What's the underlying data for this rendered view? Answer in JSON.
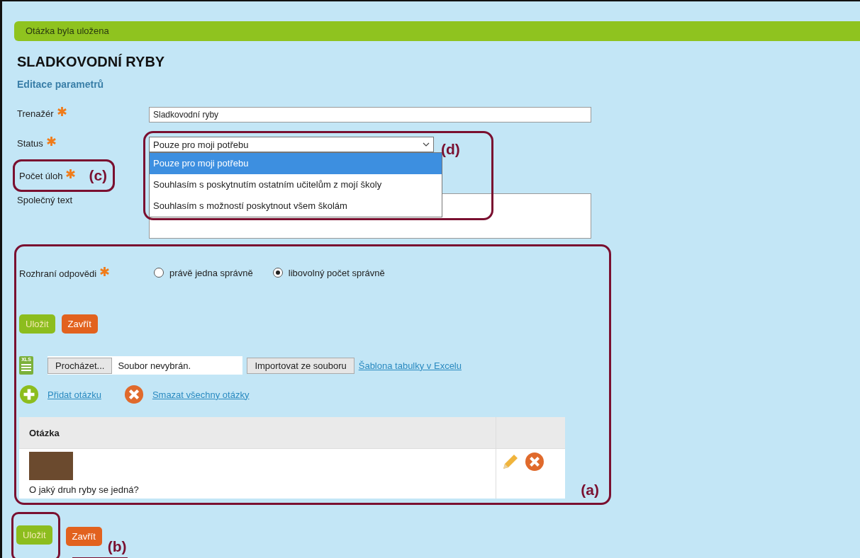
{
  "notice": "Otázka byla uložena",
  "title": "SLADKOVODNÍ RYBY",
  "subtitle": "Editace parametrů",
  "fields": [
    {
      "label": "Trenažér",
      "required": true,
      "kind": "text",
      "value": "Sladkovodní ryby"
    },
    {
      "label": "Status",
      "required": true,
      "kind": "select",
      "value": "Pouze pro moji potřebu",
      "annotation": "(d)",
      "options": [
        {
          "label": "Pouze pro moji potřebu",
          "selected": true
        },
        {
          "label": "Souhlasím s poskytnutím ostatním učitelům z mojí školy",
          "selected": false
        },
        {
          "label": "Souhlasím s možností poskytnout všem školám",
          "selected": false
        }
      ]
    },
    {
      "label": "Počet úloh",
      "required": true,
      "kind": "none",
      "annotation": "(c)"
    },
    {
      "label": "Společný text",
      "required": false,
      "kind": "textarea"
    }
  ],
  "answer_section": {
    "annotation": "(a)",
    "interface": {
      "label": "Rozhraní odpovědi",
      "required": true,
      "options": [
        {
          "label": "právě jedna správně",
          "selected": false
        },
        {
          "label": "libovolný počet správně",
          "selected": true
        }
      ]
    },
    "buttons": [
      {
        "label": "Uložit",
        "kind": "save"
      },
      {
        "label": "Zavřít",
        "kind": "close"
      }
    ],
    "import": {
      "icon_label": "XLS",
      "browse": "Procházet...",
      "file": "Soubor nevybrán.",
      "import": "Importovat ze souboru",
      "template_link": "Šablona tabulky v Excelu"
    },
    "actions": [
      {
        "label": "Přidat otázku",
        "kind": "add"
      },
      {
        "label": "Smazat všechny otázky",
        "kind": "delete"
      }
    ],
    "table": {
      "columns": [
        "Otázka"
      ],
      "rows": [
        {
          "text": "O jaký druh ryby se jedná?"
        }
      ]
    }
  },
  "bottom": {
    "annotation": "(b)",
    "buttons": [
      {
        "label": "Uložit",
        "kind": "save"
      },
      {
        "label": "Zavřít",
        "kind": "close"
      }
    ]
  }
}
